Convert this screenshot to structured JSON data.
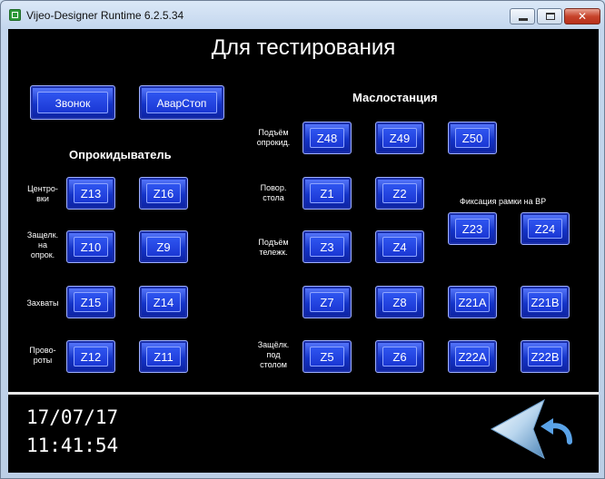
{
  "window": {
    "title": "Vijeo-Designer Runtime 6.2.5.34",
    "controls": {
      "minimize": "minimize-icon",
      "maximize": "maximize-icon",
      "close": "✕"
    }
  },
  "screen": {
    "title": "Для тестирования",
    "buttons_top": {
      "bell": "Звонок",
      "estop": "АварСтоп"
    },
    "sections": {
      "tipper": "Опрокидыватель",
      "oil_station": "Маслостанция",
      "frame_fix": "Фиксация рамки на ВР"
    },
    "labels": {
      "centering": "Центро-\nвки",
      "latch_tipper": "Защелк.\nна\nопрок.",
      "grips": "Захваты",
      "turns": "Прово-\nроты",
      "lift_tipper": "Подъём\nопрокид.",
      "turn_table": "Повор.\nстола",
      "lift_cart": "Подъём\nтележк.",
      "latch_under_table": "Защёлк.\nпод\nстолом"
    },
    "zones": {
      "z13": "Z13",
      "z16": "Z16",
      "z10": "Z10",
      "z9": "Z9",
      "z15": "Z15",
      "z14": "Z14",
      "z12": "Z12",
      "z11": "Z11",
      "z48": "Z48",
      "z49": "Z49",
      "z50": "Z50",
      "z1": "Z1",
      "z2": "Z2",
      "z3": "Z3",
      "z4": "Z4",
      "z23": "Z23",
      "z24": "Z24",
      "z7": "Z7",
      "z8": "Z8",
      "z21a": "Z21A",
      "z21b": "Z21B",
      "z5": "Z5",
      "z6": "Z6",
      "z22a": "Z22A",
      "z22b": "Z22B"
    },
    "date": "17/07/17",
    "time": "11:41:54",
    "back_icon": "back-arrow-icon"
  }
}
